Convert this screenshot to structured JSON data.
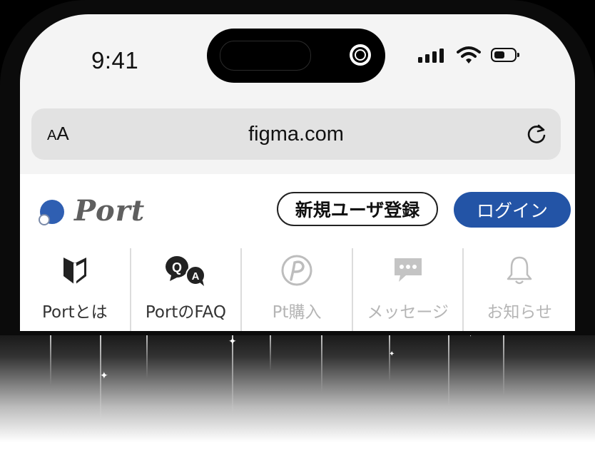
{
  "status_bar": {
    "time": "9:41"
  },
  "browser": {
    "text_size_label_small": "A",
    "text_size_label_large": "A",
    "url": "figma.com",
    "reload_icon": "reload-icon"
  },
  "site": {
    "logo_text": "Port",
    "brand_color": "#2354a6",
    "register_label": "新規ユーザ登録",
    "login_label": "ログイン"
  },
  "nav": {
    "items": [
      {
        "label": "Portとは",
        "icon": "beginner-mark-icon",
        "active": true
      },
      {
        "label": "PortのFAQ",
        "icon": "qa-icon",
        "active": true
      },
      {
        "label": "Pt購入",
        "icon": "points-icon",
        "active": false
      },
      {
        "label": "メッセージ",
        "icon": "message-icon",
        "active": false
      },
      {
        "label": "お知らせ",
        "icon": "bell-icon",
        "active": false
      }
    ]
  }
}
